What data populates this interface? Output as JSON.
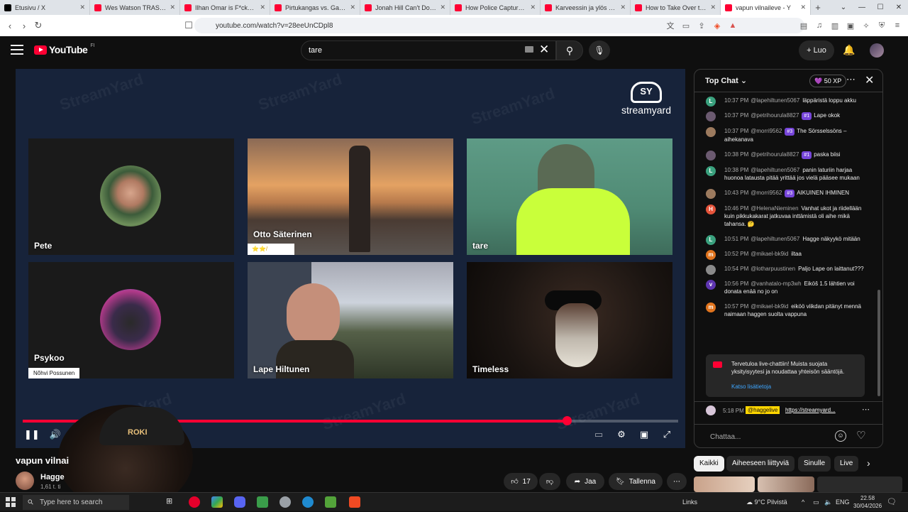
{
  "browser": {
    "tabs": [
      {
        "title": "Etusivu / X",
        "color": "#000000",
        "active": false
      },
      {
        "title": "Wes Watson TRASHES VIC",
        "color": "#ff0033",
        "active": false
      },
      {
        "title": "Ilhan Omar is F*cked. - Yo",
        "color": "#ff0033",
        "active": false
      },
      {
        "title": "Pirtukangas vs. Gadiev, Fi",
        "color": "#ff0033",
        "active": false
      },
      {
        "title": "Jonah Hill Can't Do Anythi",
        "color": "#ff0033",
        "active": false
      },
      {
        "title": "How Police Captured Flori",
        "color": "#ff0033",
        "active": false
      },
      {
        "title": "Karveessin ja ylös karveei",
        "color": "#ff0033",
        "active": false
      },
      {
        "title": "How to Take Over the Wo",
        "color": "#ff0033",
        "active": false
      },
      {
        "title": "vapun vilnaileve - Y",
        "color": "#ff0033",
        "active": true
      }
    ],
    "url": "youtube.com/watch?v=28eeUnCDpl8"
  },
  "header": {
    "logo": "YouTube",
    "region": "FI",
    "search_value": "tare",
    "create_label": "Luo"
  },
  "player": {
    "brand": "streamyard",
    "watermark": "StreamYard",
    "tiles": [
      {
        "name": "Pete",
        "key": "pete"
      },
      {
        "name": "Otto Säterinen",
        "key": "otto",
        "rating": "⭐⭐/⭐⭐⭐⭐"
      },
      {
        "name": "tare",
        "key": "tare"
      },
      {
        "name": "Psykoo",
        "key": "psykoo",
        "subtitle": "Nõhvi Possunen"
      },
      {
        "name": "Lape Hiltunen",
        "key": "lape"
      },
      {
        "name": "Timeless",
        "key": "timeless"
      }
    ],
    "progress": 0.83,
    "overlay_cap_text": "ROKI"
  },
  "video": {
    "title": "vapun vilnai",
    "channel": "Hagge",
    "subs": "1,61 t. ti",
    "likes": "17",
    "share_label": "Jaa",
    "save_label": "Tallenna"
  },
  "chat": {
    "title": "Top Chat",
    "xp": "50 XP",
    "messages": [
      {
        "time": "10:37 PM",
        "author": "@lapehiltunen5067",
        "text": "läppäristä loppu akku",
        "initial": "L",
        "color": "#3aa17e"
      },
      {
        "time": "10:37 PM",
        "author": "@petrihourula8827",
        "badge": "#1",
        "text": "Lape okok",
        "initial": "",
        "color": "#6b5a70"
      },
      {
        "time": "10:37 PM",
        "author": "@morri9562",
        "badge": "#3",
        "text": "The Sörsselssöns – aihekanava",
        "initial": "",
        "color": "#9c7a5e"
      },
      {
        "time": "10:38 PM",
        "author": "@petrihourula8827",
        "badge": "#1",
        "text": "paska biisi",
        "initial": "",
        "color": "#6b5a70"
      },
      {
        "time": "10:38 PM",
        "author": "@lapehiltunen5067",
        "text": "panin laturiin harjaa huonoa latausta pitää yrittää jos vielä pääsee mukaan",
        "initial": "L",
        "color": "#3aa17e"
      },
      {
        "time": "10:43 PM",
        "author": "@morri9562",
        "badge": "#3",
        "text": "AIKUINEN IHMINEN",
        "initial": "",
        "color": "#9c7a5e"
      },
      {
        "time": "10:46 PM",
        "author": "@HelenaNieminen",
        "text": "Vanhat ukot ja riidellään kuin pikkukakarat jatkuvaa inttämistä oli aihe mikä tahansa. 🤔",
        "initial": "H",
        "color": "#e5533a"
      },
      {
        "time": "10:51 PM",
        "author": "@lapehiltunen5067",
        "text": "Hagge näkyykö mitään",
        "initial": "L",
        "color": "#3aa17e"
      },
      {
        "time": "10:52 PM",
        "author": "@mikael-bk9id",
        "text": "iltaa",
        "initial": "m",
        "color": "#e0741e"
      },
      {
        "time": "10:54 PM",
        "author": "@lotharpuustinen",
        "text": "Paljo Lape on laittanut???",
        "initial": "",
        "color": "#8a8a8a"
      },
      {
        "time": "10:56 PM",
        "author": "@vanhatalo-mp3wh",
        "text": "Eiköš 1.5 lähtien voi donata enää no jo on",
        "initial": "v",
        "color": "#5e35b1"
      },
      {
        "time": "10:57 PM",
        "author": "@mikael-bk9id",
        "text": "eiköö viikdan pitänyt mennä naimaan haggen suolta vappuna",
        "initial": "m",
        "color": "#e0741e"
      }
    ],
    "notice": "Tervetuloa live-chattiin! Muista suojata yksityisyytesi ja noudattaa yhteisön sääntöjä.",
    "notice_link": "Katso lisätietoja",
    "pinned": {
      "time": "5:18 PM",
      "author": "@haggelive",
      "link": "https://streamyard..."
    },
    "input_placeholder": "Chattaa..."
  },
  "chips": [
    "Kaikki",
    "Aiheeseen liittyviä",
    "Sinulle",
    "Live"
  ],
  "taskbar": {
    "search_placeholder": "Type here to search",
    "links_label": "Links",
    "weather": "9°C Pilvistä",
    "lang": "ENG",
    "time": "22.58",
    "date": "30/04/2026"
  }
}
